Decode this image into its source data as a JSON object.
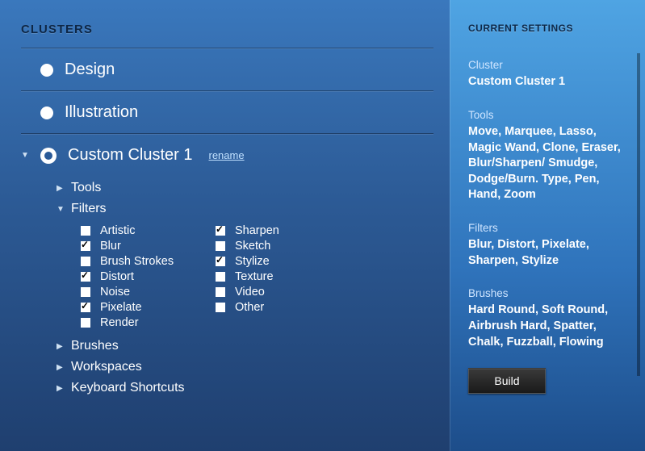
{
  "section_title": "CLUSTERS",
  "clusters": [
    {
      "label": "Design",
      "selected": false,
      "expanded": false
    },
    {
      "label": "Illustration",
      "selected": false,
      "expanded": false
    },
    {
      "label": "Custom Cluster 1",
      "selected": true,
      "expanded": true
    }
  ],
  "rename_label": "rename",
  "subtree": {
    "tools_label": "Tools",
    "filters_label": "Filters",
    "brushes_label": "Brushes",
    "workspaces_label": "Workspaces",
    "keyboard_label": "Keyboard Shortcuts"
  },
  "filters_col1": [
    {
      "label": "Artistic",
      "checked": false
    },
    {
      "label": "Blur",
      "checked": true
    },
    {
      "label": "Brush Strokes",
      "checked": false
    },
    {
      "label": "Distort",
      "checked": true
    },
    {
      "label": "Noise",
      "checked": false
    },
    {
      "label": "Pixelate",
      "checked": true
    },
    {
      "label": "Render",
      "checked": false
    }
  ],
  "filters_col2": [
    {
      "label": "Sharpen",
      "checked": true
    },
    {
      "label": "Sketch",
      "checked": false
    },
    {
      "label": "Stylize",
      "checked": true
    },
    {
      "label": "Texture",
      "checked": false
    },
    {
      "label": "Video",
      "checked": false
    },
    {
      "label": "Other",
      "checked": false
    }
  ],
  "sidebar": {
    "title": "CURRENT SETTINGS",
    "cluster_k": "Cluster",
    "cluster_v": "Custom Cluster 1",
    "tools_k": "Tools",
    "tools_v": "Move,  Marquee, Lasso, Magic Wand, Clone, Eraser, Blur/Sharpen/ Smudge, Dodge/Burn. Type, Pen, Hand, Zoom",
    "filters_k": "Filters",
    "filters_v": "Blur, Distort, Pixelate, Sharpen, Stylize",
    "brushes_k": "Brushes",
    "brushes_v": "Hard Round, Soft Round, Airbrush Hard, Spatter, Chalk, Fuzzball, Flowing",
    "build_label": "Build"
  }
}
